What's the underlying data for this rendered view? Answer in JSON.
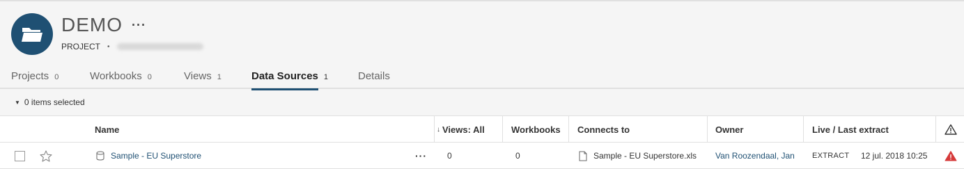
{
  "header": {
    "title": "DEMO",
    "more_label": "···",
    "type_label": "PROJECT",
    "separator": "•",
    "folder_icon": "folder-icon"
  },
  "tabs": [
    {
      "label": "Projects",
      "count": "0",
      "active": false
    },
    {
      "label": "Workbooks",
      "count": "0",
      "active": false
    },
    {
      "label": "Views",
      "count": "1",
      "active": false
    },
    {
      "label": "Data Sources",
      "count": "1",
      "active": true
    },
    {
      "label": "Details",
      "count": "",
      "active": false
    }
  ],
  "selection": {
    "caret": "▼",
    "text": "0 items selected"
  },
  "table": {
    "columns": {
      "name": "Name",
      "views": "Views: All",
      "views_sort_arrow": "↓",
      "workbooks": "Workbooks",
      "connects_to": "Connects to",
      "owner": "Owner",
      "live_extract": "Live / Last extract",
      "alert_icon": "warning-icon"
    },
    "rows": [
      {
        "name": "Sample - EU Superstore",
        "more": "···",
        "views": "0",
        "workbooks": "0",
        "connects_to": "Sample - EU Superstore.xls",
        "owner": "Van Roozendaal, Jan",
        "live_type": "EXTRACT",
        "last_extract": "12 jul. 2018 10:25",
        "alert_color": "#d63a3a"
      }
    ]
  },
  "colors": {
    "accent": "#1f5073",
    "alert": "#d63a3a"
  }
}
